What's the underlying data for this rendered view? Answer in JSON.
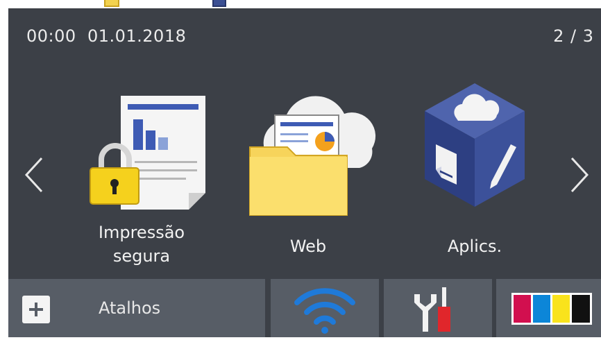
{
  "status_bar": {
    "time": "00:00",
    "date": "01.01.2018",
    "page_indicator": "2 / 3"
  },
  "tiles": [
    {
      "label_line1": "Impressão",
      "label_line2": "segura"
    },
    {
      "label": "Web"
    },
    {
      "label": "Aplics."
    }
  ],
  "bottom_bar": {
    "shortcuts_label": "Atalhos"
  },
  "colors": {
    "background": "#3c4047",
    "bottom_button": "#575d66",
    "wifi_blue": "#1f7ad9",
    "ink_magenta": "#d20f4f",
    "ink_cyan": "#0c86d8",
    "ink_yellow": "#f9e31c",
    "ink_black": "#111111"
  },
  "icons": [
    "chevron-left-icon",
    "chevron-right-icon",
    "secure-print-icon",
    "web-folder-cloud-icon",
    "apps-cube-icon",
    "plus-icon",
    "wifi-icon",
    "settings-tools-icon",
    "ink-cartridges-icon"
  ]
}
